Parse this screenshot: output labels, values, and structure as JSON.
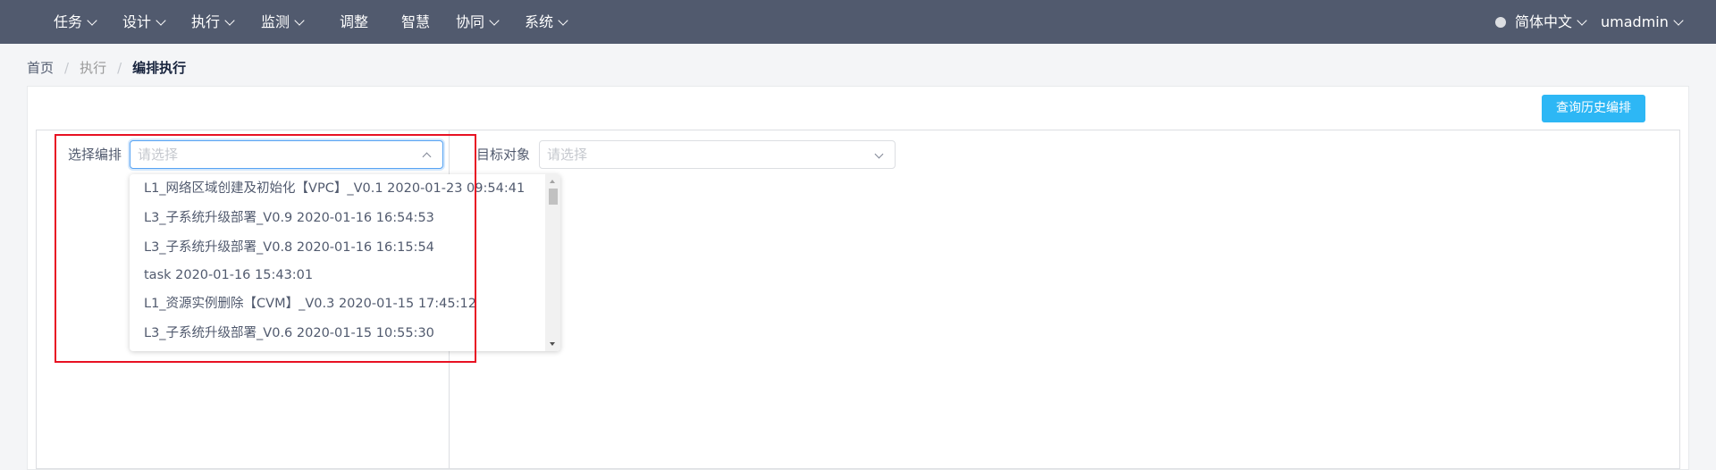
{
  "nav": {
    "items": [
      {
        "label": "任务",
        "has_caret": true
      },
      {
        "label": "设计",
        "has_caret": true
      },
      {
        "label": "执行",
        "has_caret": true
      },
      {
        "label": "监测",
        "has_caret": true
      },
      {
        "label": "调整",
        "has_caret": false
      },
      {
        "label": "智慧",
        "has_caret": false
      },
      {
        "label": "协同",
        "has_caret": true
      },
      {
        "label": "系统",
        "has_caret": true
      }
    ],
    "language": "简体中文",
    "user": "umadmin"
  },
  "breadcrumb": [
    "首页",
    "执行",
    "编排执行"
  ],
  "toolbar": {
    "history_button": "查询历史编排"
  },
  "form": {
    "orchestration": {
      "label": "选择编排",
      "placeholder": "请选择"
    },
    "target": {
      "label": "目标对象",
      "placeholder": "请选择"
    }
  },
  "dropdown": {
    "options": [
      "L1_网络区域创建及初始化【VPC】_V0.1 2020-01-23 09:54:41",
      "L3_子系统升级部署_V0.9 2020-01-16 16:54:53",
      "L3_子系统升级部署_V0.8 2020-01-16 16:15:54",
      "task 2020-01-16 15:43:01",
      "L1_资源实例删除【CVM】_V0.3 2020-01-15 17:45:12",
      "L3_子系统升级部署_V0.6 2020-01-15 10:55:30"
    ]
  },
  "colors": {
    "nav_bg": "#515a6e",
    "primary_button": "#2db7f5",
    "highlight_border": "#e81123",
    "focus_border": "#57a3f3"
  }
}
